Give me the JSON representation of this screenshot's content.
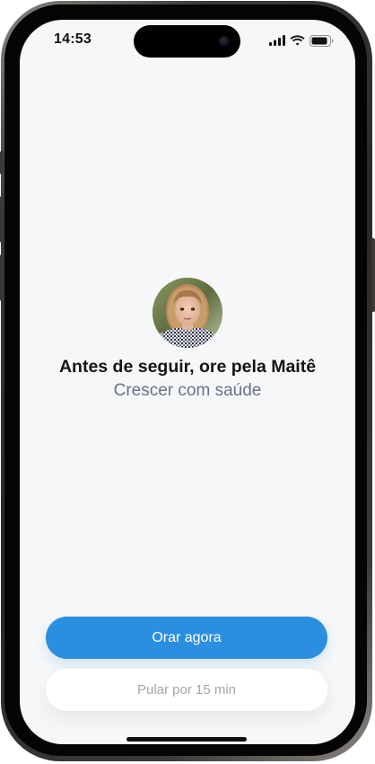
{
  "status_bar": {
    "time": "14:53",
    "icons": [
      "cellular-signal-icon",
      "wifi-icon",
      "battery-icon"
    ]
  },
  "prompt": {
    "headline": "Antes de seguir, ore pela Maitê",
    "subline": "Crescer com saúde"
  },
  "actions": {
    "primary_label": "Orar agora",
    "secondary_label": "Pular por 15 min"
  },
  "colors": {
    "screen_background": "#f6f7f8",
    "primary_button": "#2b8fe0",
    "subline_text": "#6a7189",
    "secondary_text": "#a3a6ad"
  }
}
